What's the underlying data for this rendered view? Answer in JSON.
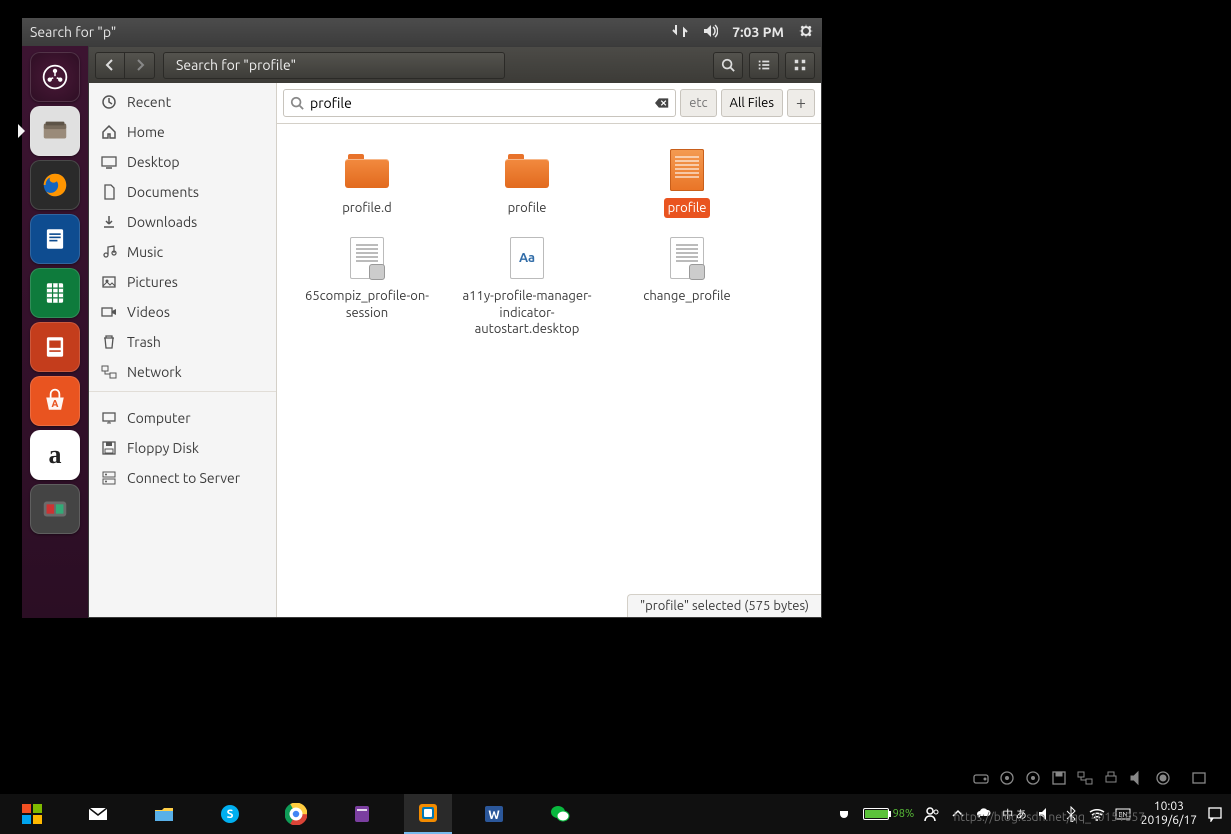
{
  "ubuntu": {
    "menubar": {
      "title": "Search for \"p\"",
      "time": "7:03 PM"
    },
    "launcher": [
      {
        "name": "dash",
        "label": "Dash"
      },
      {
        "name": "files",
        "label": "Files",
        "active": true
      },
      {
        "name": "firefox",
        "label": "Firefox"
      },
      {
        "name": "writer",
        "label": "LibreOffice Writer"
      },
      {
        "name": "calc",
        "label": "LibreOffice Calc"
      },
      {
        "name": "impress",
        "label": "LibreOffice Impress"
      },
      {
        "name": "software",
        "label": "Ubuntu Software"
      },
      {
        "name": "amazon",
        "label": "Amazon"
      },
      {
        "name": "settings",
        "label": "System Settings"
      }
    ],
    "files_window": {
      "path_label": "Search for \"profile\"",
      "search_value": "profile",
      "filters": {
        "etc": "etc",
        "all": "All Files"
      },
      "sidebar": [
        {
          "label": "Recent",
          "icon": "clock"
        },
        {
          "label": "Home",
          "icon": "home"
        },
        {
          "label": "Desktop",
          "icon": "desktop"
        },
        {
          "label": "Documents",
          "icon": "doc"
        },
        {
          "label": "Downloads",
          "icon": "download"
        },
        {
          "label": "Music",
          "icon": "music"
        },
        {
          "label": "Pictures",
          "icon": "pictures"
        },
        {
          "label": "Videos",
          "icon": "videos"
        },
        {
          "label": "Trash",
          "icon": "trash"
        },
        {
          "label": "Network",
          "icon": "network"
        },
        {
          "sep": true
        },
        {
          "label": "Computer",
          "icon": "computer"
        },
        {
          "label": "Floppy Disk",
          "icon": "floppy"
        },
        {
          "label": "Connect to Server",
          "icon": "server"
        }
      ],
      "results": [
        {
          "type": "folder",
          "label": "profile.d"
        },
        {
          "type": "folder",
          "label": "profile"
        },
        {
          "type": "textfile",
          "label": "profile",
          "selected": true
        },
        {
          "type": "script",
          "label": "65compiz_profile-on-session"
        },
        {
          "type": "font",
          "label": "a11y-profile-manager-indicator-autostart.desktop"
        },
        {
          "type": "script",
          "label": "change_profile"
        }
      ],
      "status": "\"profile\" selected  (575 bytes)"
    }
  },
  "host": {
    "battery_pct": "98%",
    "time": "10:03",
    "date": "2019/6/17",
    "watermark": "https://blog.csdn.net/qq_40151857"
  }
}
